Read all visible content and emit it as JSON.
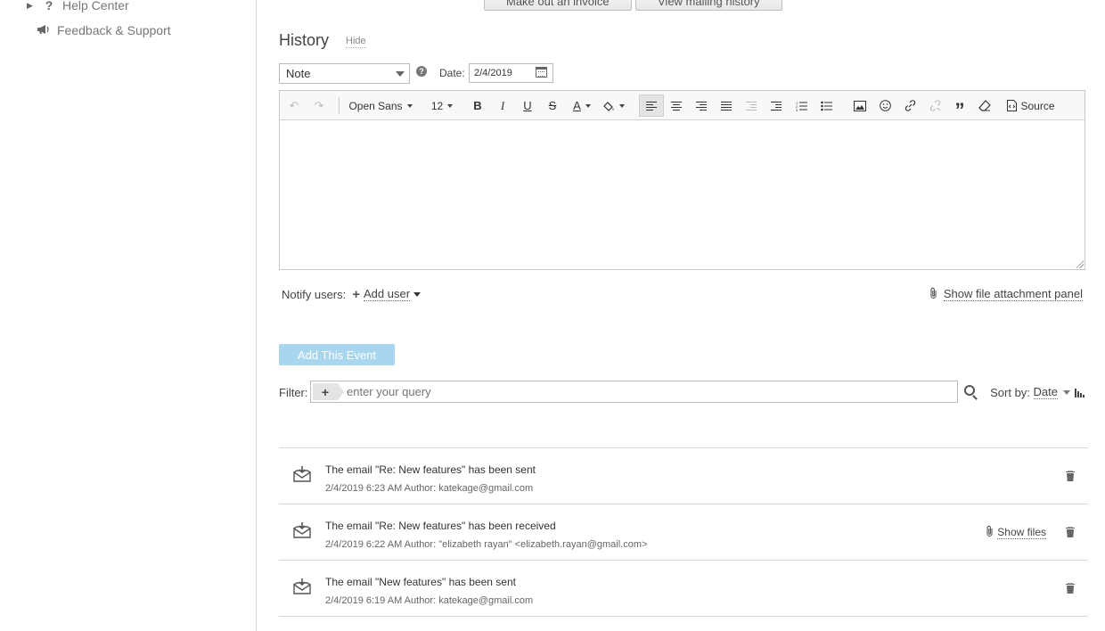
{
  "sidebar": {
    "items": [
      {
        "label": "Help Center",
        "icon": "question-icon"
      },
      {
        "label": "Feedback & Support",
        "icon": "megaphone-icon"
      }
    ]
  },
  "top_buttons": {
    "invoice": "Make out an invoice",
    "mailing_history": "View mailing history"
  },
  "history": {
    "title": "History",
    "hide_label": "Hide",
    "type_value": "Note",
    "date_label": "Date:",
    "date_value": "2/4/2019"
  },
  "editor": {
    "font_family": "Open Sans",
    "font_size": "12",
    "source_label": "Source"
  },
  "notify": {
    "label": "Notify users:",
    "add_user": "Add user"
  },
  "attachment": {
    "label": "Show file attachment panel"
  },
  "add_event_label": "Add This Event",
  "filter": {
    "label": "Filter:",
    "placeholder": "enter your query"
  },
  "sort": {
    "label": "Sort by:",
    "value": "Date"
  },
  "events": [
    {
      "title": "The email \"Re: New features\" has been sent",
      "meta": "2/4/2019 6:23 AM Author: katekage@gmail.com",
      "has_files": false
    },
    {
      "title": "The email \"Re: New features\" has been received",
      "meta": "2/4/2019 6:22 AM Author: \"elizabeth rayan\" <elizabeth.rayan@gmail.com>",
      "has_files": true,
      "files_label": "Show files"
    },
    {
      "title": "The email \"New features\" has been sent",
      "meta": "2/4/2019 6:19 AM Author: katekage@gmail.com",
      "has_files": false
    }
  ],
  "colors": {
    "add_event_bg": "#a8d6ee",
    "border": "#d8d8d8"
  }
}
